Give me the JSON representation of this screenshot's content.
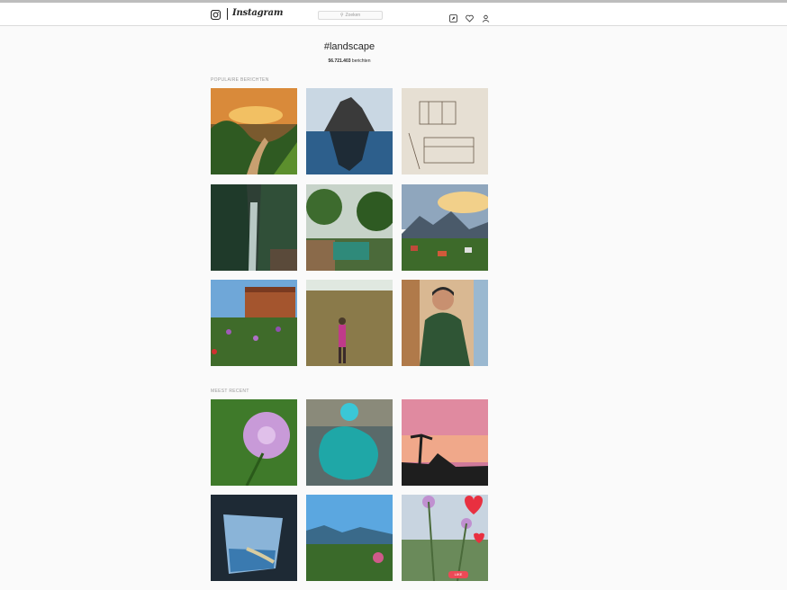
{
  "nav": {
    "logo_word": "Instagram",
    "search_placeholder": "Zoeken",
    "icons": [
      "camera-icon",
      "compass-icon",
      "heart-icon",
      "user-icon"
    ]
  },
  "hashtag": {
    "title": "#landscape",
    "count": "56.721.403",
    "count_suffix": "berichten"
  },
  "sections": {
    "popular_label": "POPULAIRE BERICHTEN",
    "recent_label": "MEEST RECENT"
  },
  "popular_posts": [
    {
      "subject": "sunset-river-valley"
    },
    {
      "subject": "rock-island-iceberg"
    },
    {
      "subject": "architecture-sketch"
    },
    {
      "subject": "waterfall-gorge"
    },
    {
      "subject": "garden-pool-trees"
    },
    {
      "subject": "mountain-village"
    },
    {
      "subject": "brick-house-wildflowers"
    },
    {
      "subject": "woman-in-reeds"
    },
    {
      "subject": "man-green-sweater"
    }
  ],
  "recent_posts": [
    {
      "subject": "purple-thistle-flower"
    },
    {
      "subject": "aerial-pool-resort"
    },
    {
      "subject": "pink-sunset-palms"
    },
    {
      "subject": "airplane-window-coast"
    },
    {
      "subject": "mountain-lake-view"
    },
    {
      "subject": "flowers-with-hearts",
      "badge": "LIKE"
    }
  ],
  "colors": {
    "background": "#fafafa",
    "nav_background": "#ffffff",
    "border": "#dbdbdb",
    "text": "#262626",
    "muted": "#999999"
  }
}
